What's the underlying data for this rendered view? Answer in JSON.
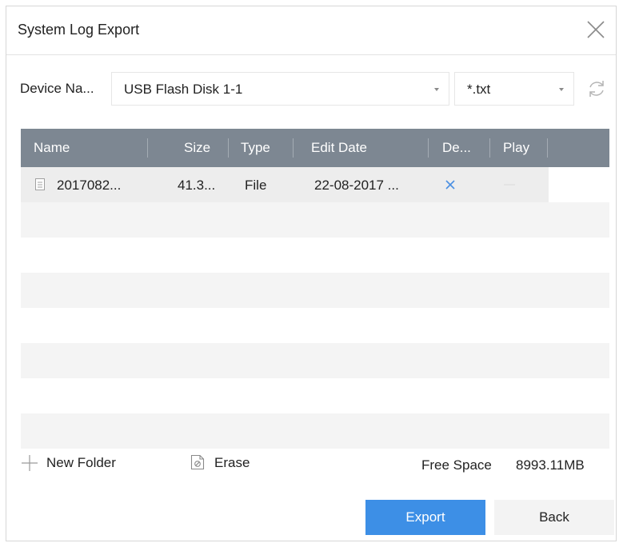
{
  "dialog": {
    "title": "System Log Export"
  },
  "device": {
    "label": "Device Na...",
    "selected": "USB Flash Disk 1-1"
  },
  "filter": {
    "selected": "*.txt"
  },
  "table": {
    "columns": [
      "Name",
      "Size",
      "Type",
      "Edit Date",
      "De...",
      "Play"
    ],
    "rows": [
      {
        "name": "2017082...",
        "size": "41.3...",
        "type": "File",
        "edit_date": "22-08-2017 ..."
      }
    ]
  },
  "footer": {
    "new_folder": "New Folder",
    "erase": "Erase",
    "free_space_label": "Free Space",
    "free_space_value": "8993.11MB"
  },
  "buttons": {
    "export": "Export",
    "back": "Back"
  },
  "icons": {
    "close": "close-icon",
    "refresh": "refresh-icon",
    "file": "file-icon",
    "delete": "delete-icon",
    "play": "play-icon",
    "new_folder": "plus-icon",
    "erase": "erase-icon"
  },
  "colors": {
    "header": "#7d8792",
    "primary": "#3d8fe6",
    "delete": "#4a90e2"
  }
}
